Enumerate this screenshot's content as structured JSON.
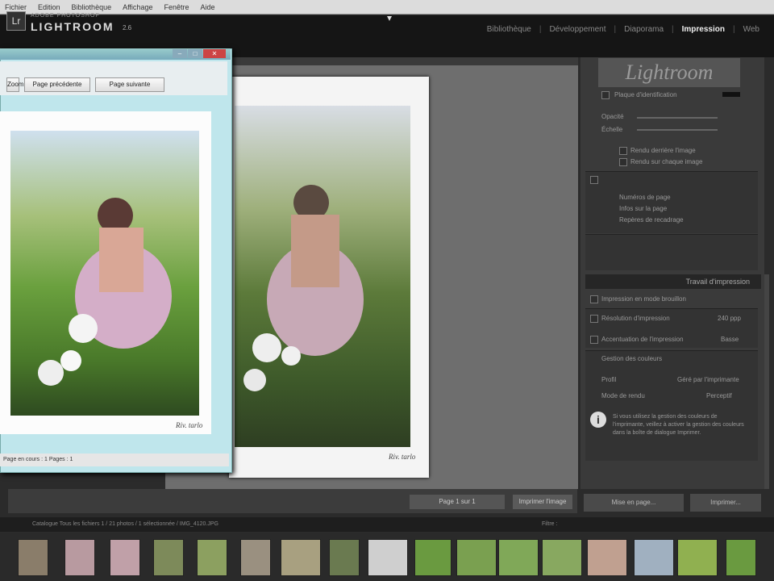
{
  "os_menu": {
    "items": [
      "Fichier",
      "Edition",
      "Bibliothèque",
      "Affichage",
      "Fenêtre",
      "Aide"
    ]
  },
  "app": {
    "logo_line1": "ADOBE PHOTOSHOP",
    "logo_line2": "LIGHTROOM",
    "version": "2.6",
    "logo_glyph": "Lr"
  },
  "modules": [
    {
      "label": "Bibliothèque",
      "active": false
    },
    {
      "label": "Développement",
      "active": false
    },
    {
      "label": "Diaporama",
      "active": false
    },
    {
      "label": "Impression",
      "active": true
    },
    {
      "label": "Web",
      "active": false
    }
  ],
  "canvas": {
    "signature": "Riv. tarlo",
    "page_indicator": "Page 1 sur 1",
    "toolbar_button": "Imprimer l'image"
  },
  "right_panel": {
    "identity_plate": "Lightroom",
    "overlay_rows": [
      "Plaque d'identification",
      "Opacité",
      "Échelle",
      "Rendu derrière l'image",
      "Rendu sur chaque image",
      "Numéros de page",
      "Infos sur la page",
      "Repères de recadrage"
    ],
    "header_label": "Travail d'impression",
    "job_rows": [
      {
        "label": "Impression en mode brouillon",
        "value": ""
      },
      {
        "label": "Résolution d'impression",
        "value": "240 ppp"
      },
      {
        "label": "Accentuation de l'impression",
        "value": "Basse"
      },
      {
        "label": "Gestion des couleurs",
        "value": ""
      },
      {
        "label": "Profil",
        "value": "Géré par l'imprimante"
      },
      {
        "label": "Mode de rendu",
        "value": "Perceptif"
      }
    ],
    "info_icon": "i",
    "info_text": "Si vous utilisez la gestion des couleurs de l'imprimante, veillez à activer la gestion des couleurs dans la boîte de dialogue Imprimer.",
    "button_left": "Mise en page...",
    "button_right": "Imprimer..."
  },
  "filmstrip": {
    "path": "Catalogue   Tous les fichiers   1 / 21 photos / 1 sélectionnée / IMG_4120.JPG",
    "filter_label": "Filtre :"
  },
  "preview_window": {
    "title": "",
    "buttons": [
      "Zoom",
      "Page précédente",
      "Page suivante"
    ],
    "signature": "Riv. tarlo",
    "status": "Page en cours :  1     Pages :  1"
  },
  "colors": {
    "accent_active": "#eeeeee",
    "preview_bg": "#bfe6ec"
  },
  "icons": {
    "info": "info-icon",
    "close": "close-icon",
    "minimize": "minimize-icon",
    "maximize": "maximize-icon"
  }
}
